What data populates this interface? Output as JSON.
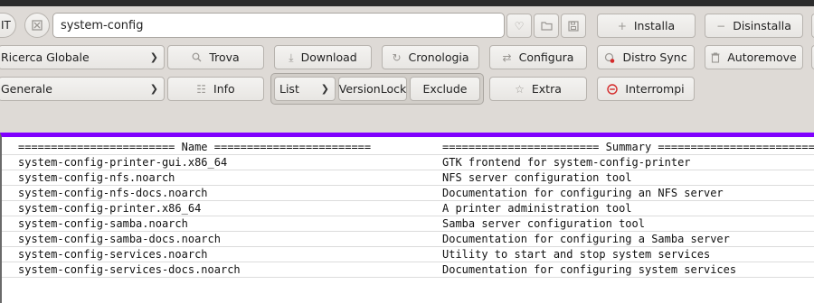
{
  "toolbar": {
    "language": "IT",
    "search_value": "system-config",
    "install_label": "Installa",
    "uninstall_label": "Disinstalla",
    "find_label": "Trova",
    "download_label": "Download",
    "history_label": "Cronologia",
    "configure_label": "Configura",
    "distrosync_label": "Distro Sync",
    "autoremove_label": "Autoremove",
    "info_label": "Info",
    "extra_label": "Extra",
    "interrupt_label": "Interrompi",
    "search_scope": "Ricerca Globale",
    "filter": "Generale",
    "list_mode": "List",
    "versionlock_label": "VersionLock",
    "exclude_label": "Exclude"
  },
  "results": {
    "header_name": "======================== Name ========================",
    "header_summary": "======================== Summary ========================",
    "rows": [
      {
        "name": "system-config-printer-gui.x86_64",
        "summary": "GTK frontend for system-config-printer"
      },
      {
        "name": "system-config-nfs.noarch",
        "summary": "NFS server configuration tool"
      },
      {
        "name": "system-config-nfs-docs.noarch",
        "summary": "Documentation for configuring an NFS server"
      },
      {
        "name": "system-config-printer.x86_64",
        "summary": "A printer administration tool"
      },
      {
        "name": "system-config-samba.noarch",
        "summary": "Samba server configuration tool"
      },
      {
        "name": "system-config-samba-docs.noarch",
        "summary": "Documentation for configuring a Samba server"
      },
      {
        "name": "system-config-services.noarch",
        "summary": "Utility to start and stop system services"
      },
      {
        "name": "system-config-services-docs.noarch",
        "summary": "Documentation for configuring system services"
      }
    ]
  },
  "colors": {
    "accent": "#8000ff",
    "interrupt_icon": "#d42a2a"
  }
}
